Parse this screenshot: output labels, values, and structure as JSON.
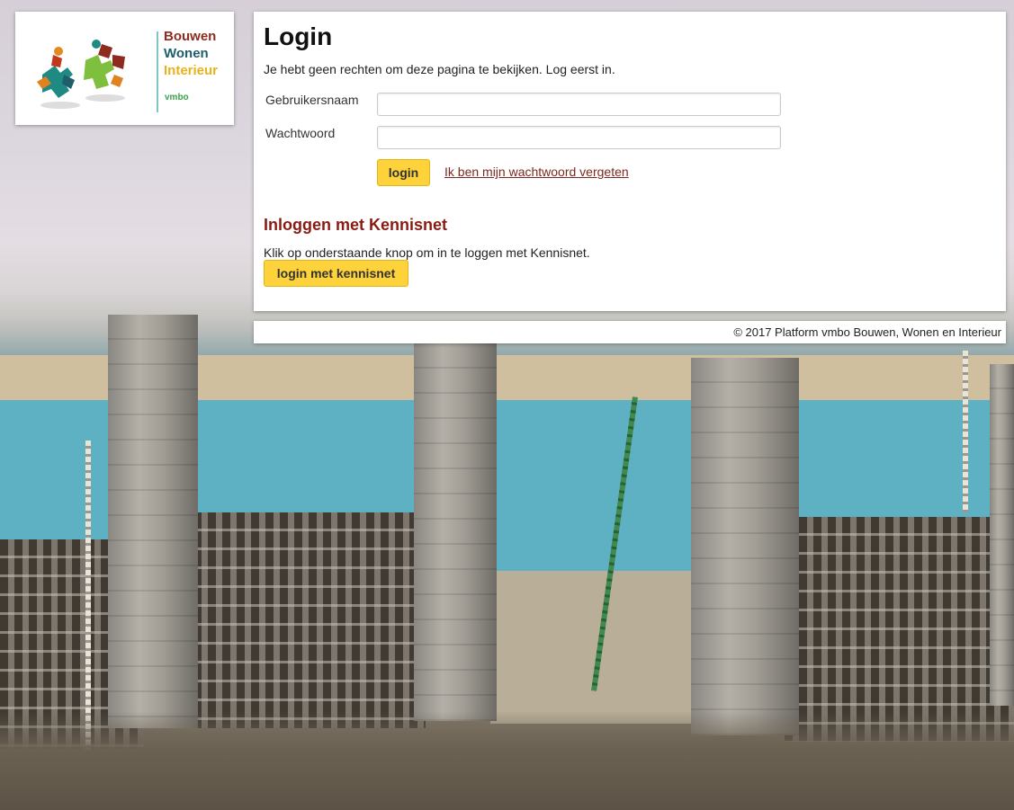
{
  "logo": {
    "line1": "Bouwen",
    "line2": "Wonen",
    "line3": "Interieur",
    "sub": "vmbo"
  },
  "login": {
    "title": "Login",
    "notice": "Je hebt geen rechten om deze pagina te bekijken. Log eerst in.",
    "username_label": "Gebruikersnaam",
    "username_value": "",
    "password_label": "Wachtwoord",
    "password_value": "",
    "submit_label": "login",
    "forgot_label": "Ik ben mijn wachtwoord vergeten"
  },
  "kennisnet": {
    "heading": "Inloggen met Kennisnet",
    "text": "Klik op onderstaande knop om in te loggen met Kennisnet.",
    "button_label": "login met kennisnet"
  },
  "footer": {
    "text": "© 2017 Platform vmbo Bouwen, Wonen en Interieur"
  },
  "colors": {
    "button_bg": "#fdd23a",
    "heading_red": "#8b1a12",
    "link_brown": "#7a2a1f"
  }
}
